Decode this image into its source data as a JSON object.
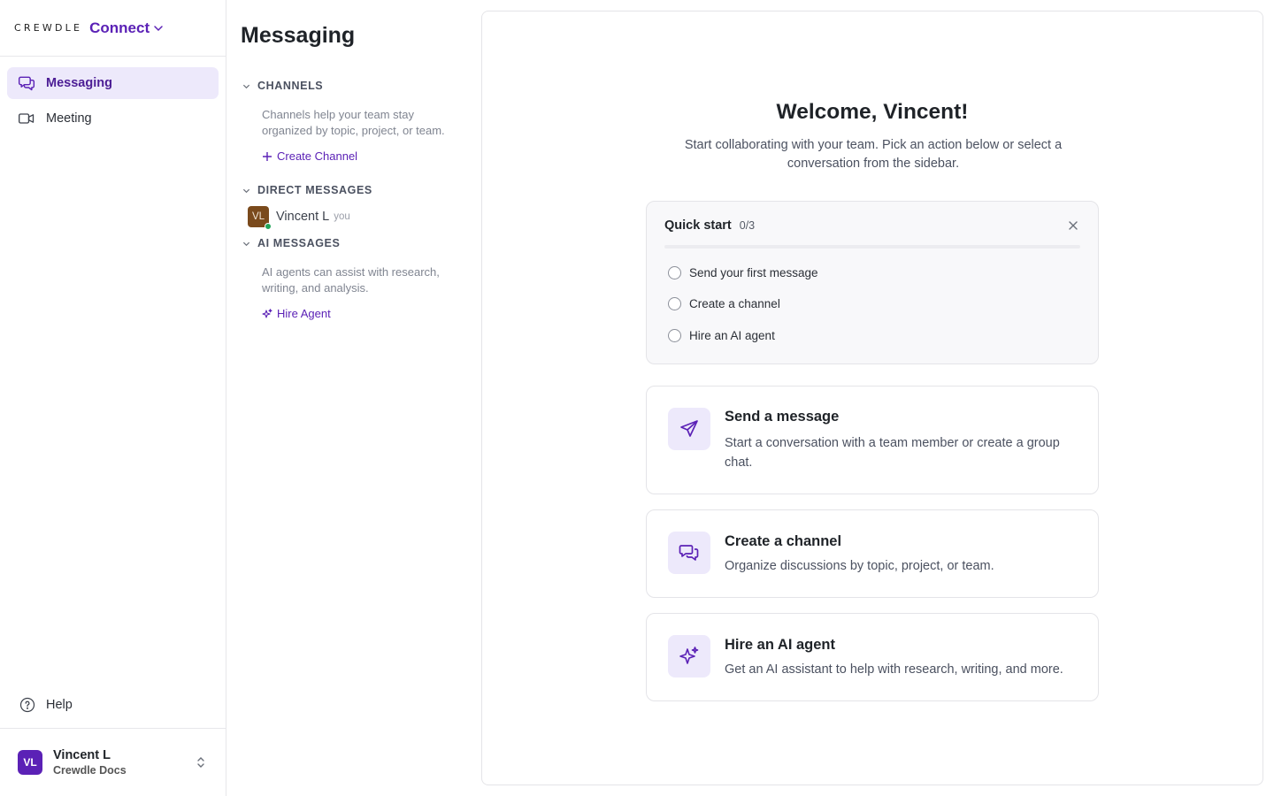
{
  "brand": {
    "wordmark": "CREWDLE",
    "product": "Connect"
  },
  "nav": {
    "items": [
      {
        "label": "Messaging",
        "icon": "chat-bubbles-icon",
        "active": true
      },
      {
        "label": "Meeting",
        "icon": "video-camera-icon",
        "active": false
      }
    ],
    "help_label": "Help"
  },
  "user": {
    "initials": "VL",
    "name": "Vincent L",
    "org": "Crewdle Docs"
  },
  "sidebar": {
    "title": "Messaging",
    "channels": {
      "heading": "CHANNELS",
      "description": "Channels help your team stay organized by topic, project, or team.",
      "action": "Create Channel"
    },
    "direct_messages": {
      "heading": "DIRECT MESSAGES",
      "items": [
        {
          "initials": "VL",
          "name": "Vincent L",
          "suffix": "you",
          "online": true
        }
      ]
    },
    "ai_messages": {
      "heading": "AI MESSAGES",
      "description": "AI agents can assist with research, writing, and analysis.",
      "action": "Hire Agent"
    }
  },
  "main": {
    "welcome": "Welcome, Vincent!",
    "subtitle": "Start collaborating with your team. Pick an action below or select a conversation from the sidebar.",
    "quick_start": {
      "title": "Quick start",
      "count": "0/3",
      "progress": 0,
      "items": [
        "Send your first message",
        "Create a channel",
        "Hire an AI agent"
      ]
    },
    "cards": [
      {
        "title": "Send a message",
        "description": "Start a conversation with a team member or create a group chat.",
        "icon": "paper-plane-icon"
      },
      {
        "title": "Create a channel",
        "description": "Organize discussions by topic, project, or team.",
        "icon": "chat-bubbles-icon"
      },
      {
        "title": "Hire an AI agent",
        "description": "Get an AI assistant to help with research, writing, and more.",
        "icon": "sparkles-icon"
      }
    ]
  },
  "colors": {
    "accent": "#5b21b6",
    "accent_bg": "#ede9fb",
    "online": "#22a55a"
  }
}
